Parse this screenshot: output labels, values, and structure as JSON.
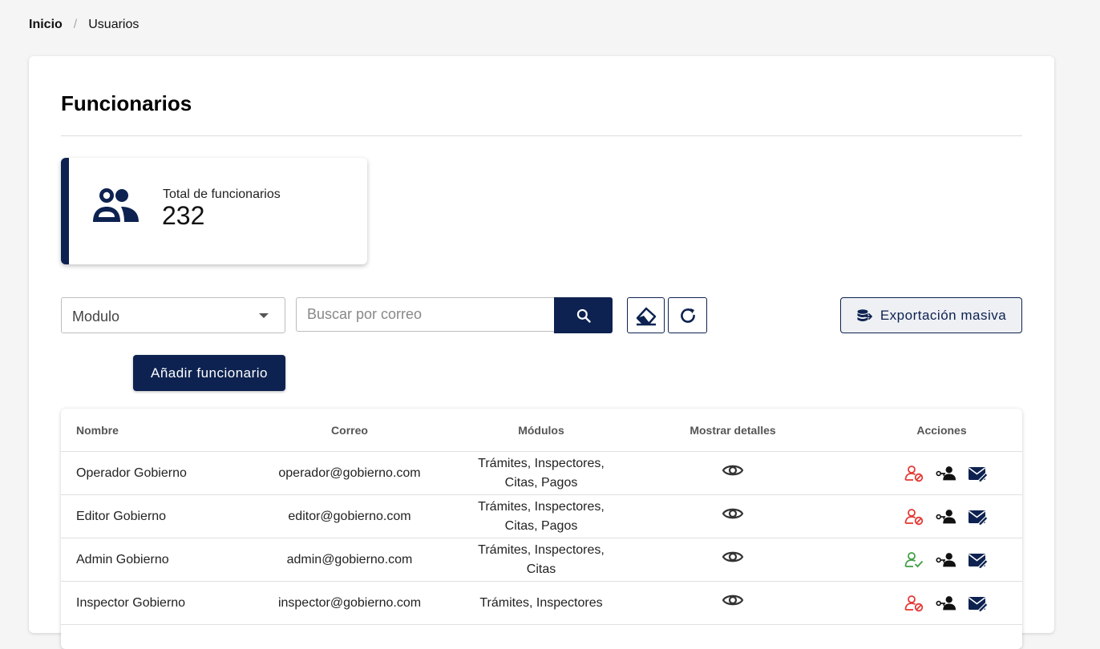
{
  "breadcrumb": {
    "home": "Inicio",
    "separator": "/",
    "current": "Usuarios"
  },
  "page": {
    "title": "Funcionarios"
  },
  "stat": {
    "label": "Total de funcionarios",
    "value": "232",
    "icon": "users-icon"
  },
  "filters": {
    "module_select": {
      "value": "Modulo"
    },
    "search": {
      "placeholder": "Buscar por correo",
      "value": ""
    },
    "search_icon": "search-icon",
    "clear_icon": "eraser-icon",
    "refresh_icon": "refresh-icon"
  },
  "export_button": {
    "label": "Exportación masiva",
    "icon": "database-export-icon"
  },
  "add_button": {
    "label": "Añadir funcionario"
  },
  "table": {
    "headers": {
      "name": "Nombre",
      "email": "Correo",
      "modules": "Módulos",
      "details": "Mostrar detalles",
      "actions": "Acciones"
    },
    "rows": [
      {
        "name": "Operador Gobierno",
        "email": "operador@gobierno.com",
        "modules": "Trámites, Inspectores, Citas, Pagos",
        "status": "inactive"
      },
      {
        "name": "Editor Gobierno",
        "email": "editor@gobierno.com",
        "modules": "Trámites, Inspectores, Citas, Pagos",
        "status": "inactive"
      },
      {
        "name": "Admin Gobierno",
        "email": "admin@gobierno.com",
        "modules": "Trámites, Inspectores, Citas",
        "status": "active"
      },
      {
        "name": "Inspector Gobierno",
        "email": "inspector@gobierno.com",
        "modules": "Trámites, Inspectores",
        "status": "inactive"
      }
    ]
  },
  "colors": {
    "primary": "#0d2250",
    "danger": "#e53935",
    "success": "#43a047"
  }
}
